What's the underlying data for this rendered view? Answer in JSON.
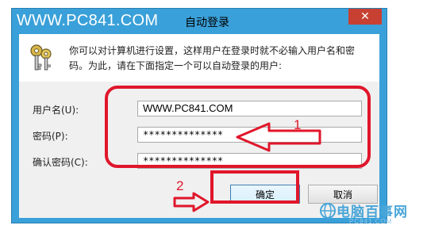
{
  "window": {
    "site_title": "WWW.PC841.COM",
    "title": "自动登录",
    "close_glyph": "✕",
    "accent_color": "#3aa0d9"
  },
  "info": {
    "icon": "keys-icon",
    "line1": "你可以对计算机进行设置，这样用户在登录时就不必输入用户名和密",
    "line2": "码。为此，请在下面指定一个可以自动登录的用户:"
  },
  "form": {
    "username_label": "用户名(U):",
    "username_value": "WWW.PC841.COM",
    "password_label": "密码(P):",
    "password_value": "**************",
    "confirm_label": "确认密码(C):",
    "confirm_value": "**************"
  },
  "buttons": {
    "ok_label": "确定",
    "cancel_label": "取消"
  },
  "annotations": {
    "step1": "1",
    "step2": "2",
    "color": "#e0162b"
  },
  "watermark": {
    "text": "电脑百事网",
    "sub": "PC841.COM"
  }
}
